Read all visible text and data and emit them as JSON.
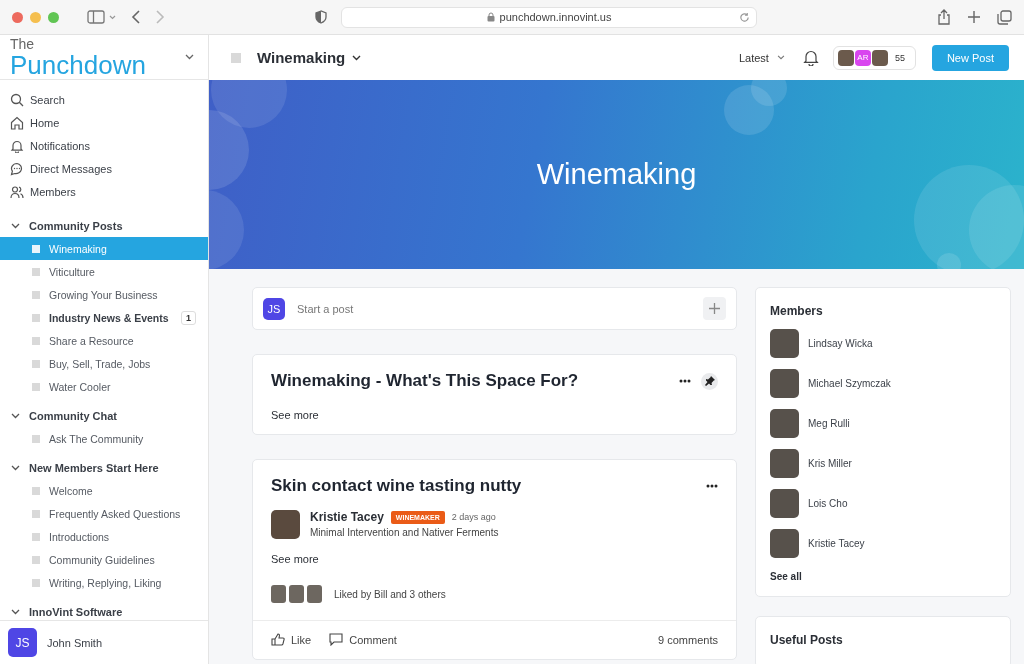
{
  "browser": {
    "url": "punchdown.innovint.us"
  },
  "sidebar": {
    "logo_small": "The",
    "logo": "Punchdown",
    "nav": [
      {
        "kind": "search",
        "label": "Search"
      },
      {
        "kind": "home",
        "label": "Home"
      },
      {
        "kind": "bell",
        "label": "Notifications"
      },
      {
        "kind": "chat",
        "label": "Direct Messages"
      },
      {
        "kind": "people",
        "label": "Members"
      }
    ],
    "sections": [
      {
        "title": "Community Posts",
        "expanded": true,
        "items": [
          {
            "label": "Winemaking",
            "selected": true,
            "unread": false
          },
          {
            "label": "Viticulture",
            "selected": false,
            "unread": false
          },
          {
            "label": "Growing Your Business",
            "selected": false,
            "unread": false
          },
          {
            "label": "Industry News & Events",
            "selected": false,
            "unread": true,
            "badge": "1"
          },
          {
            "label": "Share a Resource",
            "selected": false,
            "unread": false
          },
          {
            "label": "Buy, Sell, Trade, Jobs",
            "selected": false,
            "unread": false
          },
          {
            "label": "Water Cooler",
            "selected": false,
            "unread": false
          }
        ]
      },
      {
        "title": "Community Chat",
        "expanded": true,
        "items": [
          {
            "label": "Ask The Community",
            "selected": false,
            "unread": false
          }
        ]
      },
      {
        "title": "New Members Start Here",
        "expanded": true,
        "items": [
          {
            "label": "Welcome",
            "selected": false,
            "unread": false
          },
          {
            "label": "Frequently Asked Questions",
            "selected": false,
            "unread": false
          },
          {
            "label": "Introductions",
            "selected": false,
            "unread": false
          },
          {
            "label": "Community Guidelines",
            "selected": false,
            "unread": false
          },
          {
            "label": "Writing, Replying, Liking",
            "selected": false,
            "unread": false
          }
        ]
      },
      {
        "title": "InnoVint Software",
        "expanded": true
      }
    ],
    "user": {
      "initials": "JS",
      "name": "John Smith"
    }
  },
  "header": {
    "space": "Winemaking",
    "sort": "Latest",
    "avatars": [
      {
        "kind": "photo"
      },
      {
        "kind": "initials",
        "initials": "AR"
      },
      {
        "kind": "photo"
      }
    ],
    "member_count": "55",
    "new_post": "New Post"
  },
  "banner": {
    "title": "Winemaking"
  },
  "composer": {
    "initials": "JS",
    "placeholder": "Start a post"
  },
  "posts": [
    {
      "kind": "pinned",
      "title": "Winemaking - What's This Space For?",
      "pinned": true,
      "see_more": "See more"
    },
    {
      "kind": "full",
      "title": "Skin contact wine tasting nutty",
      "pinned": false,
      "author": "Kristie Tacey",
      "badge": "WINEMAKER",
      "time": "2 days ago",
      "subtitle": "Minimal Intervention and Nativer Ferments",
      "see_more": "See more",
      "likes": "Liked by Bill and 3 others",
      "like": "Like",
      "comment": "Comment",
      "comments": "9 comments"
    }
  ],
  "members_card": {
    "title": "Members",
    "members": [
      "Lindsay Wicka",
      "Michael Szymczak",
      "Meg Rulli",
      "Kris Miller",
      "Lois Cho",
      "Kristie Tacey"
    ],
    "see_all": "See all"
  },
  "useful_posts": {
    "title": "Useful Posts"
  }
}
